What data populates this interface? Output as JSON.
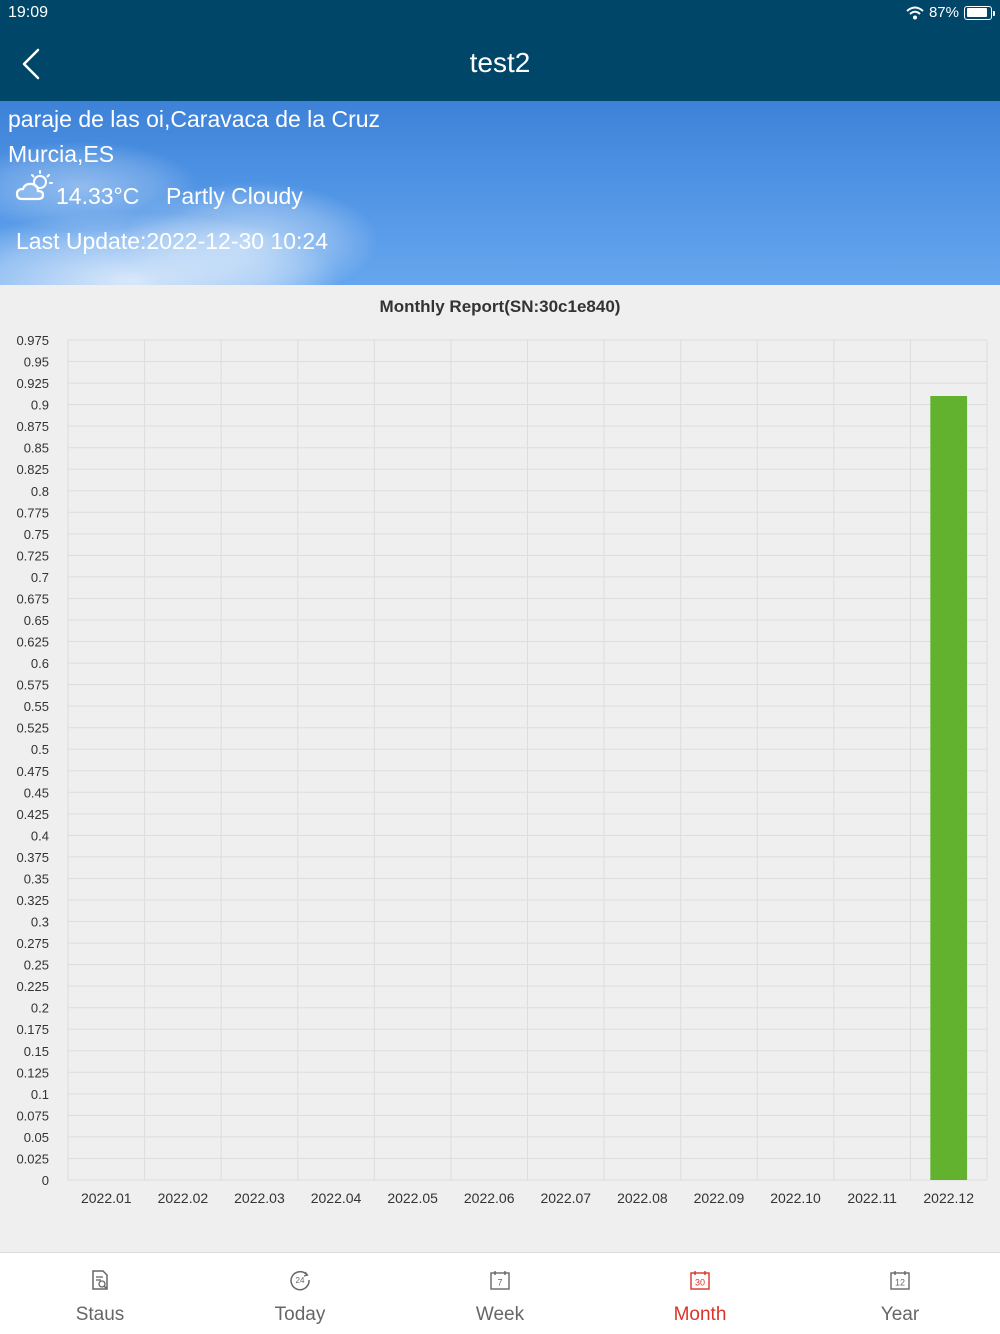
{
  "status_bar": {
    "time": "19:09",
    "battery": "87%",
    "battery_level": 0.87
  },
  "nav": {
    "title": "test2"
  },
  "weather": {
    "location_line1": "paraje de las oi,Caravaca de la Cruz",
    "location_line2": "Murcia,ES",
    "temperature": "14.33°C",
    "condition": "Partly Cloudy",
    "last_update": "Last Update:2022-12-30 10:24",
    "icon": "partly-cloudy-icon"
  },
  "chart_data": {
    "type": "bar",
    "title": "Monthly Report(SN:30c1e840)",
    "categories": [
      "2022.01",
      "2022.02",
      "2022.03",
      "2022.04",
      "2022.05",
      "2022.06",
      "2022.07",
      "2022.08",
      "2022.09",
      "2022.10",
      "2022.11",
      "2022.12"
    ],
    "values": [
      0,
      0,
      0,
      0,
      0,
      0,
      0,
      0,
      0,
      0,
      0,
      0.91
    ],
    "ylim": [
      0,
      0.975
    ],
    "ytick_step": 0.025,
    "grid": true,
    "bar_color": "#63b22f"
  },
  "tabs": [
    {
      "label": "Staus",
      "icon": "status-report-icon",
      "active": false
    },
    {
      "label": "Today",
      "icon": "24h-clock-icon",
      "active": false
    },
    {
      "label": "Week",
      "icon": "calendar-7-icon",
      "active": false
    },
    {
      "label": "Month",
      "icon": "calendar-30-icon",
      "active": true
    },
    {
      "label": "Year",
      "icon": "calendar-12-icon",
      "active": false
    }
  ],
  "colors": {
    "header": "#004669",
    "accent": "#d9342b",
    "tab_inactive": "#666666"
  }
}
